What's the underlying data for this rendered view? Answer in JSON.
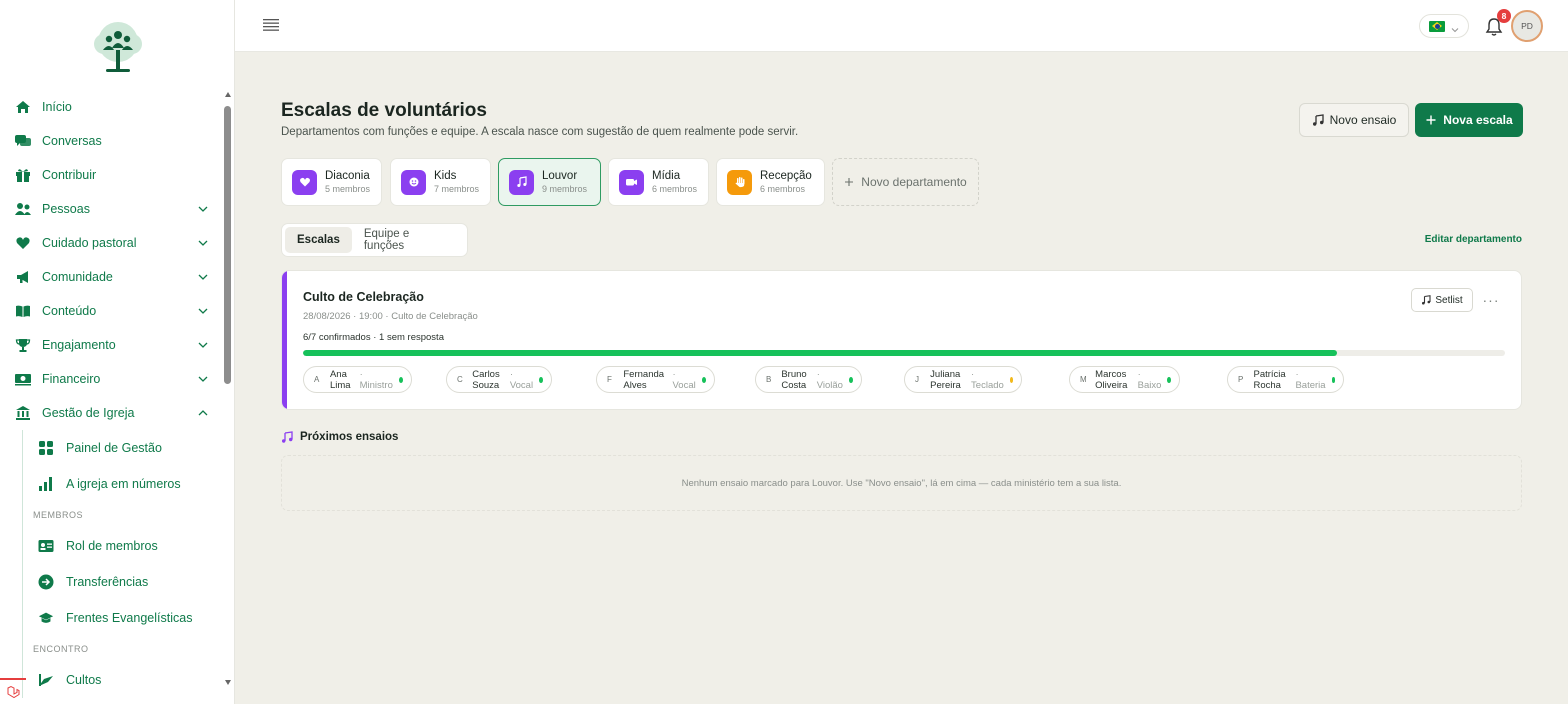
{
  "sidebar": {
    "items": [
      {
        "label": "Início",
        "icon": "home-icon"
      },
      {
        "label": "Conversas",
        "icon": "chat-icon"
      },
      {
        "label": "Contribuir",
        "icon": "gift-icon"
      },
      {
        "label": "Pessoas",
        "icon": "people-icon"
      },
      {
        "label": "Cuidado pastoral",
        "icon": "heart-icon"
      },
      {
        "label": "Comunidade",
        "icon": "megaphone-icon"
      },
      {
        "label": "Conteúdo",
        "icon": "book-icon"
      },
      {
        "label": "Engajamento",
        "icon": "trophy-icon"
      },
      {
        "label": "Financeiro",
        "icon": "money-icon"
      },
      {
        "label": "Gestão de Igreja",
        "icon": "bank-icon"
      }
    ],
    "sub_items": [
      {
        "label": "Painel de Gestão",
        "icon": "grid-icon"
      },
      {
        "label": "A igreja em números",
        "icon": "bar-chart-icon"
      }
    ],
    "section_membros": "MEMBROS",
    "membros_items": [
      {
        "label": "Rol de membros",
        "icon": "id-card-icon"
      },
      {
        "label": "Transferências",
        "icon": "arrow-circle-icon"
      },
      {
        "label": "Frentes Evangelísticas",
        "icon": "graduation-cap-icon"
      }
    ],
    "section_encontro": "ENCONTRO",
    "encontro_items": [
      {
        "label": "Cultos",
        "icon": "worship-icon"
      }
    ]
  },
  "topbar": {
    "notification_count": "8",
    "avatar_initials": "PD"
  },
  "page": {
    "title": "Escalas de voluntários",
    "subtitle": "Departamentos com funções e equipe. A escala nasce com sugestão de quem realmente pode servir.",
    "btn_novo_ensaio": "Novo ensaio",
    "btn_nova_escala": "Nova escala"
  },
  "departments": [
    {
      "name": "Diaconia",
      "count": "5 membros",
      "color": "#8b3ff0",
      "icon": "heart-icon"
    },
    {
      "name": "Kids",
      "count": "7 membros",
      "color": "#8b3ff0",
      "icon": "smile-icon"
    },
    {
      "name": "Louvor",
      "count": "9 membros",
      "color": "#8b3ff0",
      "icon": "music-note-icon"
    },
    {
      "name": "Mídia",
      "count": "6 membros",
      "color": "#8b3ff0",
      "icon": "video-icon"
    },
    {
      "name": "Recepção",
      "count": "6 membros",
      "color": "#f59a0b",
      "icon": "hand-icon"
    }
  ],
  "new_department": "Novo departamento",
  "tabs": [
    "Escalas",
    "Equipe e funções"
  ],
  "edit_department": "Editar departamento",
  "event": {
    "title": "Culto de Celebração",
    "meta": "28/08/2026 · 19:00 · Culto de Celebração",
    "status": "6/7 confirmados · 1 sem resposta",
    "progress_fraction": 0.86,
    "setlist": "Setlist",
    "volunteers": [
      {
        "initial": "A",
        "name": "Ana Lima",
        "role": "· Ministro",
        "status_color": "#16c15a"
      },
      {
        "initial": "C",
        "name": "Carlos Souza",
        "role": "· Vocal",
        "status_color": "#16c15a"
      },
      {
        "initial": "F",
        "name": "Fernanda Alves",
        "role": "· Vocal",
        "status_color": "#16c15a"
      },
      {
        "initial": "B",
        "name": "Bruno Costa",
        "role": "· Violão",
        "status_color": "#16c15a"
      },
      {
        "initial": "J",
        "name": "Juliana Pereira",
        "role": "· Teclado",
        "status_color": "#f2b91b"
      },
      {
        "initial": "M",
        "name": "Marcos Oliveira",
        "role": "· Baixo",
        "status_color": "#16c15a"
      },
      {
        "initial": "P",
        "name": "Patrícia Rocha",
        "role": "· Bateria",
        "status_color": "#16c15a"
      }
    ]
  },
  "rehearsals": {
    "title": "Próximos ensaios",
    "empty": "Nenhum ensaio marcado para Louvor. Use \"Novo ensaio\", lá em cima — cada ministério tem a sua lista."
  },
  "colors": {
    "brand_green": "#0f7a4a",
    "accent_purple": "#8b3ff0",
    "progress_green": "#16c15a"
  }
}
